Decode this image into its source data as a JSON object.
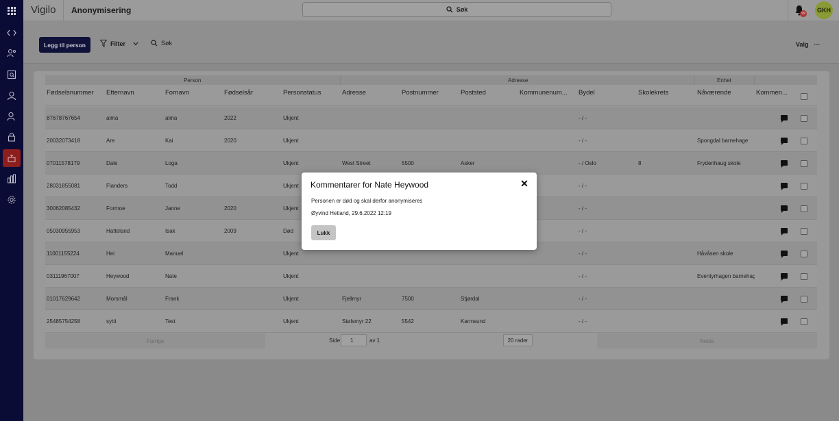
{
  "header": {
    "brand": "Vigilo",
    "page_title": "Anonymisering",
    "search_label": "Søk",
    "notification_count": "99",
    "avatar_initials": "GKH"
  },
  "sidebar": {
    "items": [
      {
        "icon": "code-icon"
      },
      {
        "icon": "users-search-icon"
      },
      {
        "icon": "report-search-icon"
      },
      {
        "icon": "user-icon"
      },
      {
        "icon": "person-icon"
      },
      {
        "icon": "lock-icon"
      },
      {
        "icon": "eraser-icon",
        "active": true
      },
      {
        "icon": "bar-chart-icon"
      },
      {
        "icon": "gear-icon"
      }
    ]
  },
  "toolbar": {
    "add_person": "Legg til person",
    "filter": "Filter",
    "search": "Søk",
    "valg": "Valg",
    "more": "···"
  },
  "table": {
    "groups": {
      "person": "Person",
      "adresse": "Adresse",
      "enhet": "Enhet"
    },
    "columns": [
      "Fødselsnummer",
      "Etternavn",
      "Fornavn",
      "Fødselsår",
      "Personstatus",
      "Adresse",
      "Postnummer",
      "Poststed",
      "Kommunenum...",
      "Bydel",
      "Skolekrets",
      "Nåværende",
      "Kommen..."
    ],
    "rows": [
      {
        "fnr": "87678767654",
        "etternavn": "alma",
        "fornavn": "alma",
        "aar": "2022",
        "status": "Ukjent",
        "adresse": "",
        "postnr": "",
        "poststed": "",
        "kommune": "",
        "bydel": "- / -",
        "skolekrets": "",
        "enhet": ""
      },
      {
        "fnr": "20032073418",
        "etternavn": "Are",
        "fornavn": "Kai",
        "aar": "2020",
        "status": "Ukjent",
        "adresse": "",
        "postnr": "",
        "poststed": "",
        "kommune": "",
        "bydel": "- / -",
        "skolekrets": "",
        "enhet": "Spongdal barnehage"
      },
      {
        "fnr": "07011578179",
        "etternavn": "Dale",
        "fornavn": "Loga",
        "aar": "",
        "status": "Ukjent",
        "adresse": "West Street",
        "postnr": "5500",
        "poststed": "Asker",
        "kommune": "",
        "bydel": "- / Oslo",
        "skolekrets": "8",
        "enhet": "Frydenhaug skole"
      },
      {
        "fnr": "28031855081",
        "etternavn": "Flanders",
        "fornavn": "Todd",
        "aar": "",
        "status": "Ukjent",
        "adresse": "",
        "postnr": "",
        "poststed": "",
        "kommune": "",
        "bydel": "- / -",
        "skolekrets": "",
        "enhet": ""
      },
      {
        "fnr": "30062085432",
        "etternavn": "Formoe",
        "fornavn": "Janne",
        "aar": "2020",
        "status": "Ukjent",
        "adresse": "",
        "postnr": "",
        "poststed": "",
        "kommune": "",
        "bydel": "- / -",
        "skolekrets": "",
        "enhet": ""
      },
      {
        "fnr": "05030955953",
        "etternavn": "Hatteland",
        "fornavn": "Isak",
        "aar": "2009",
        "status": "Død",
        "adresse": "",
        "postnr": "",
        "poststed": "",
        "kommune": "",
        "bydel": "- / -",
        "skolekrets": "",
        "enhet": ""
      },
      {
        "fnr": "11001155224",
        "etternavn": "Hei",
        "fornavn": "Manuel",
        "aar": "",
        "status": "Ukjent",
        "adresse": "",
        "postnr": "",
        "poststed": "",
        "kommune": "",
        "bydel": "- / -",
        "skolekrets": "",
        "enhet": "Håvåsen skole"
      },
      {
        "fnr": "03111967007",
        "etternavn": "Heywood",
        "fornavn": "Nate",
        "aar": "",
        "status": "Ukjent",
        "adresse": "",
        "postnr": "",
        "poststed": "",
        "kommune": "",
        "bydel": "- / -",
        "skolekrets": "",
        "enhet": "Eventyrhagen barnehag"
      },
      {
        "fnr": "01017629642",
        "etternavn": "Morsmål",
        "fornavn": "Frank",
        "aar": "",
        "status": "Ukjent",
        "adresse": "Fjellmyr",
        "postnr": "7500",
        "poststed": "Stjørdal",
        "kommune": "",
        "bydel": "- / -",
        "skolekrets": "",
        "enhet": ""
      },
      {
        "fnr": "25485754258",
        "etternavn": "sytti",
        "fornavn": "Test",
        "aar": "",
        "status": "Ukjent",
        "adresse": "Stølsmyr 22",
        "postnr": "5542",
        "poststed": "Karmsund",
        "kommune": "",
        "bydel": "- / -",
        "skolekrets": "",
        "enhet": ""
      }
    ]
  },
  "pager": {
    "prev": "Forrige",
    "side": "Side",
    "page": "1",
    "of": "av 1",
    "rows": "20 rader",
    "next": "Neste"
  },
  "modal": {
    "title": "Kommentarer for Nate Heywood",
    "close": "✕",
    "comment": "Personen er død og skal derfor anonymiseres",
    "meta": "Øyvind Hetland, 29.6.2022 12:19",
    "button": "Lukk"
  }
}
